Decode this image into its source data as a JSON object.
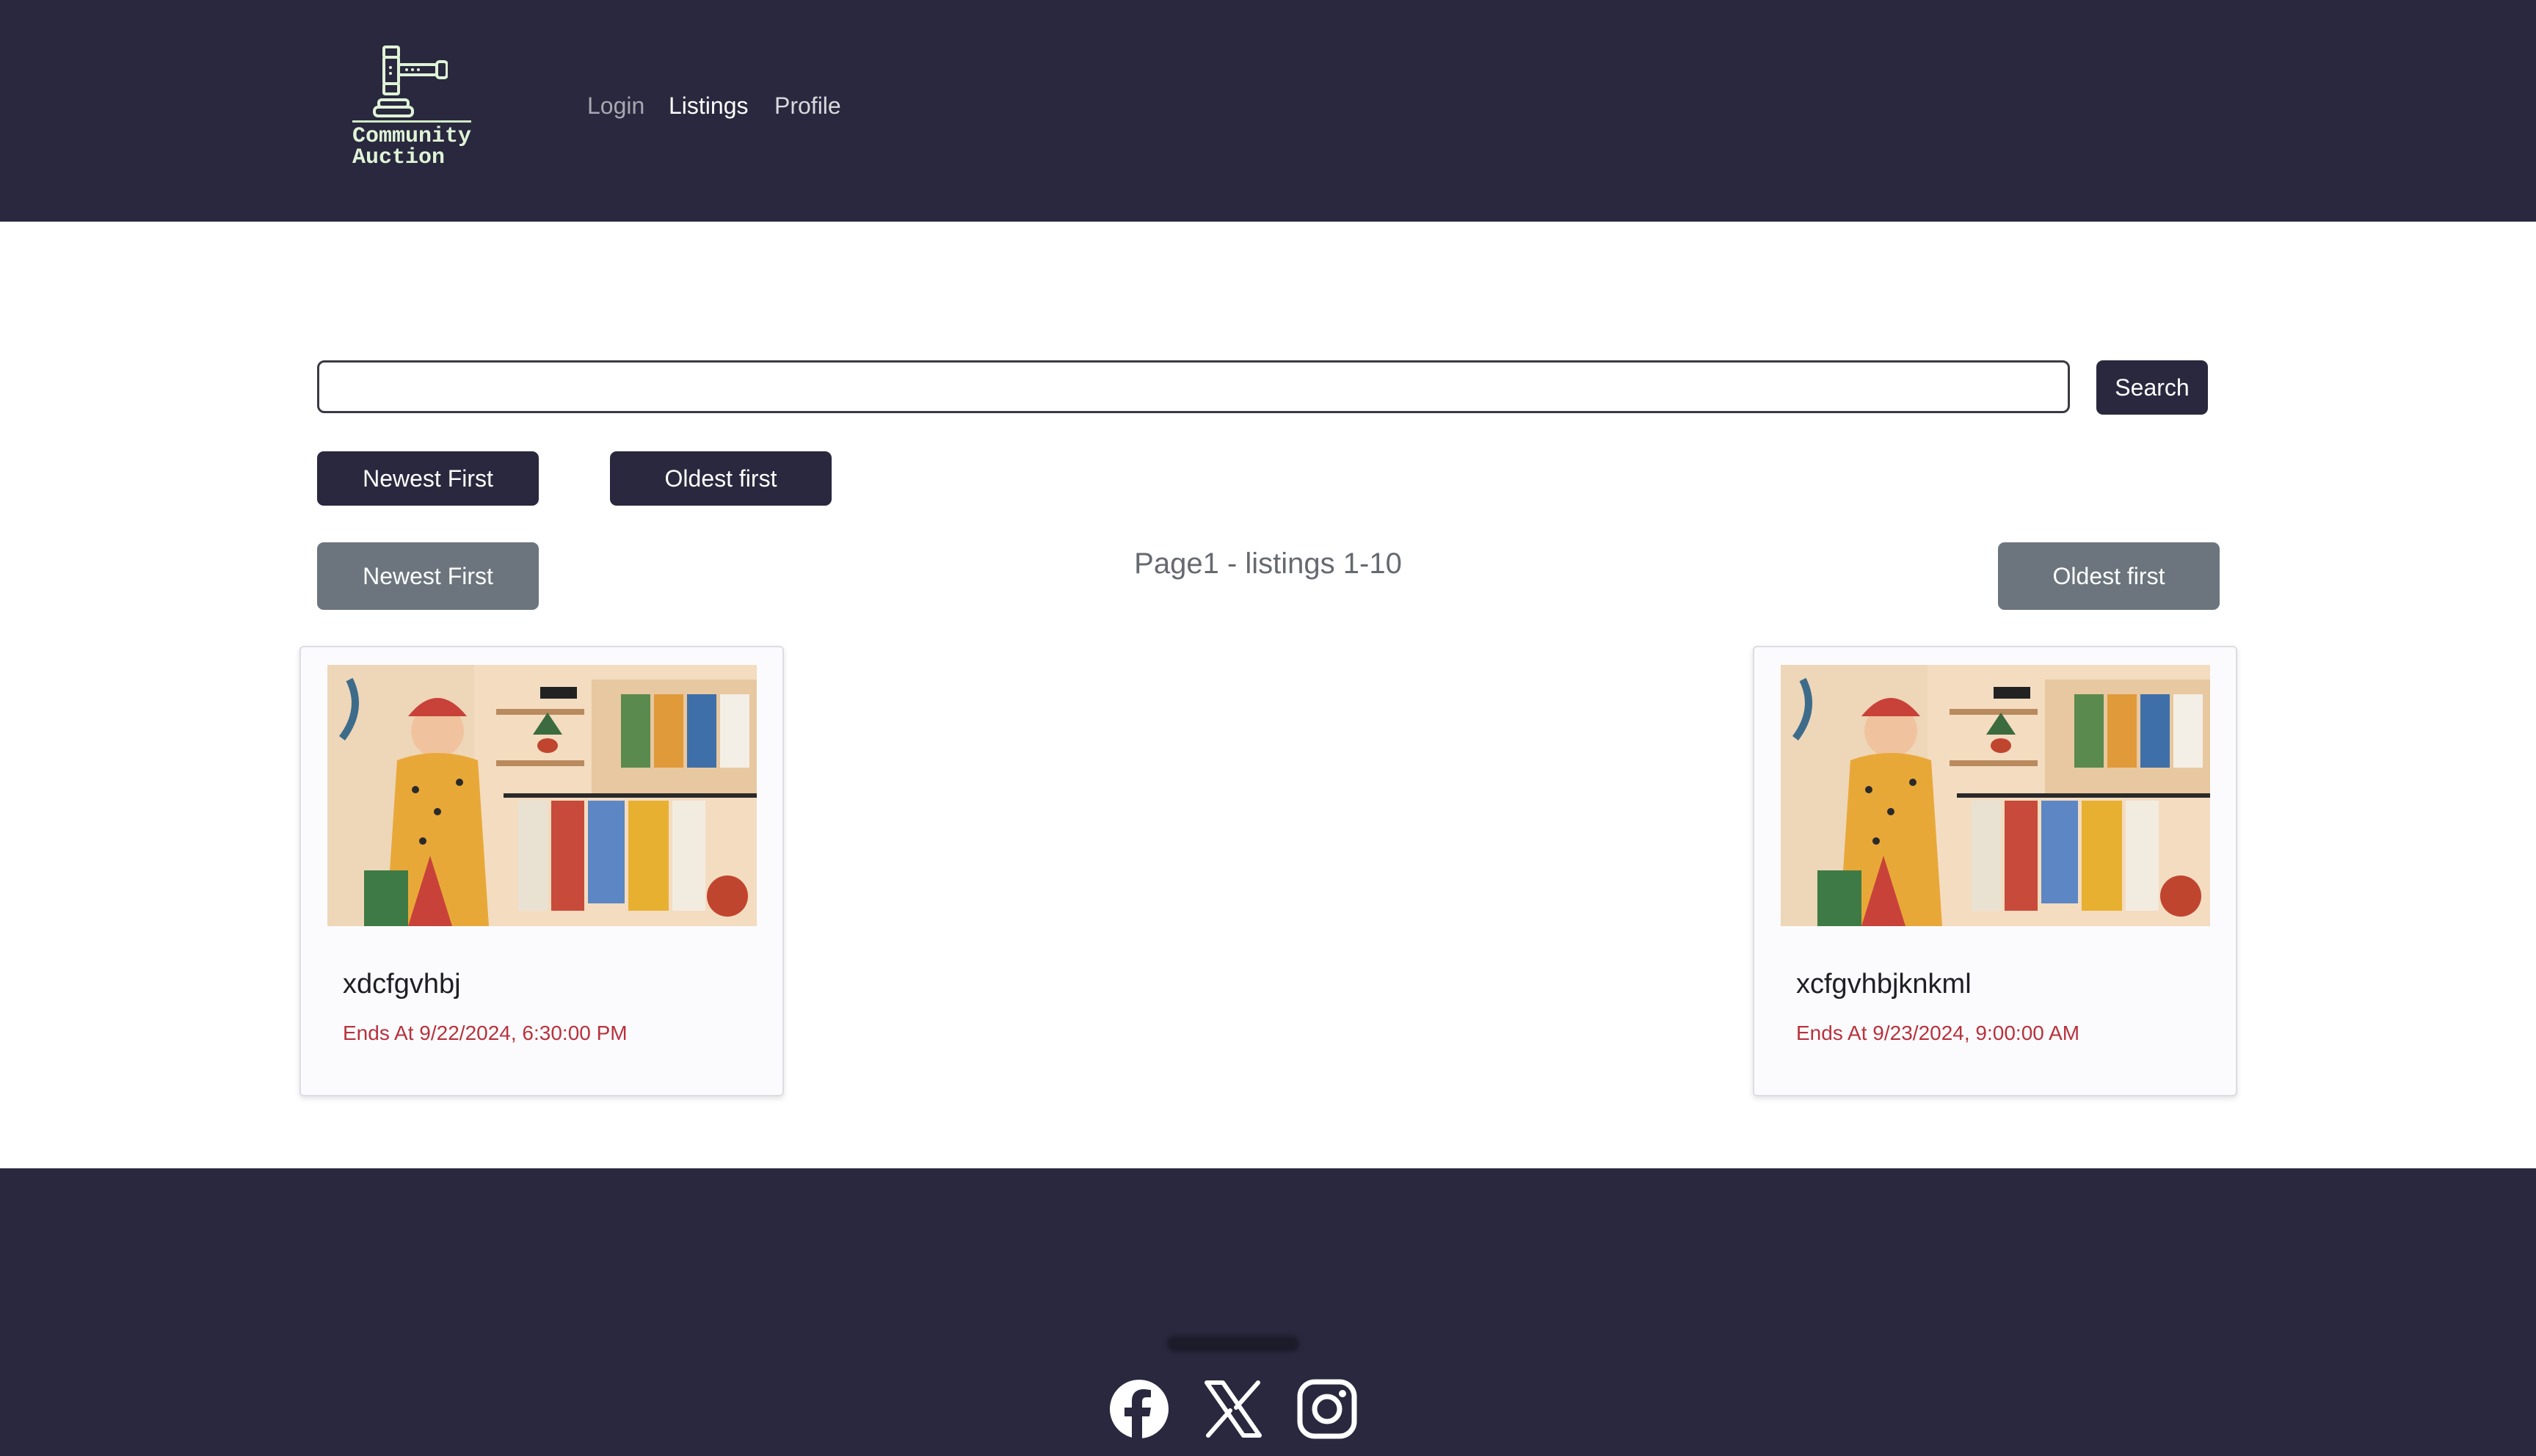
{
  "header": {
    "logo_text": "Community\nAuction",
    "nav": [
      {
        "label": "Login"
      },
      {
        "label": "Listings"
      },
      {
        "label": "Profile"
      }
    ]
  },
  "search": {
    "value": "",
    "placeholder": "",
    "button_label": "Search"
  },
  "sort_row_1": {
    "newest_label": "Newest First",
    "oldest_label": "Oldest first"
  },
  "pagination": {
    "newest_label": "Newest First",
    "page_info": "Page1 - listings 1-10",
    "oldest_label": "Oldest first"
  },
  "listings": [
    {
      "title": "xdcfgvhbj",
      "ends": "Ends At 9/22/2024, 6:30:00 PM"
    },
    {
      "title": "xcfgvhbjknkml",
      "ends": "Ends At 9/23/2024, 9:00:00 AM"
    }
  ],
  "footer": {
    "icons": [
      "facebook-icon",
      "x-twitter-icon",
      "instagram-icon"
    ]
  },
  "colors": {
    "header_bg": "#29283e",
    "button_dark": "#29283e",
    "button_gray": "#6c757d",
    "end_date_red": "#b8323c"
  }
}
